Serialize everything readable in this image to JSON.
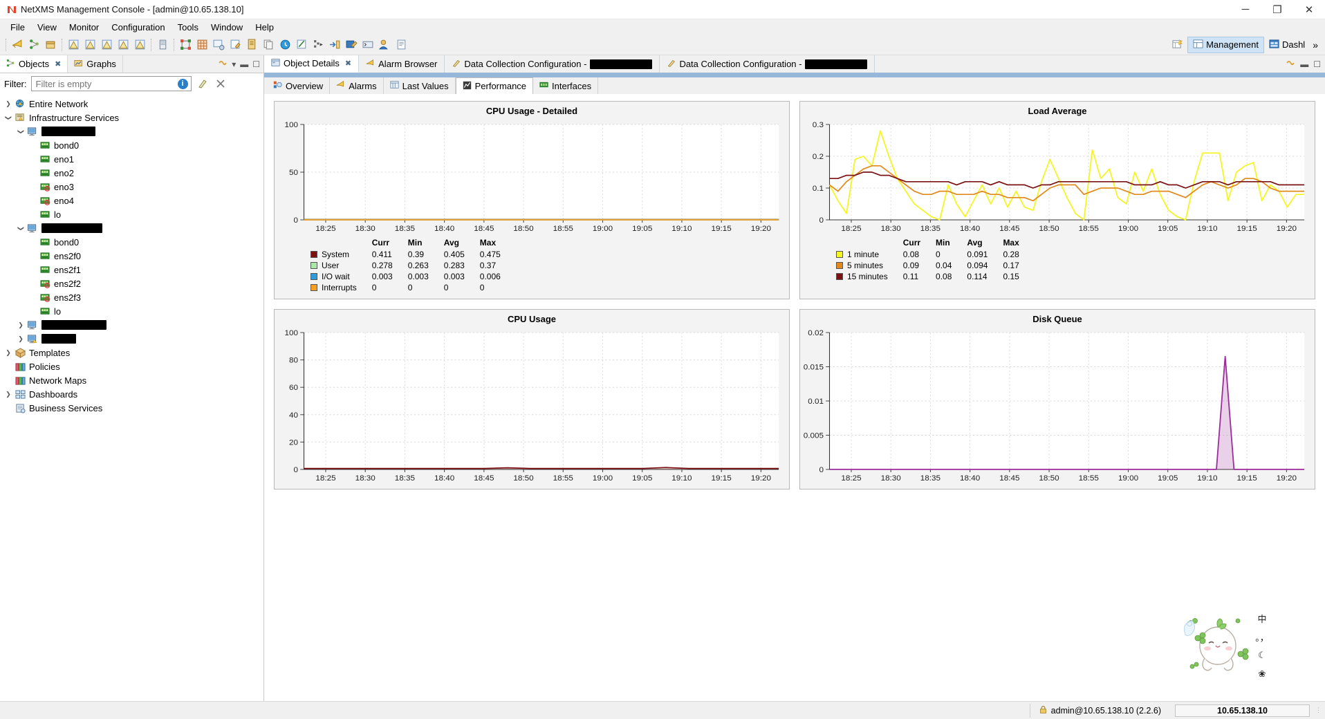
{
  "window": {
    "title": "NetXMS Management Console - [admin@10.65.138.10]",
    "app_icon": "netxms-logo-icon",
    "minimize": "─",
    "maximize": "❐",
    "close": "✕"
  },
  "menubar": {
    "items": [
      "File",
      "View",
      "Monitor",
      "Configuration",
      "Tools",
      "Window",
      "Help"
    ]
  },
  "toolbar": {
    "groups": [
      [
        "megaphone-icon",
        "node-poll-icon",
        "package-icon"
      ],
      [
        "alarm-view-icon",
        "alarm-edit-icon",
        "alarm-ack-icon",
        "alarm-resolve-icon",
        "alarm-terminate-icon"
      ],
      [
        "server-icon"
      ],
      [
        "topology-icon",
        "network-map-icon",
        "map-link-icon",
        "edit-note-icon",
        "log-icon",
        "copy-icon",
        "clock-icon",
        "script-icon",
        "execute-icon",
        "import-icon",
        "tools-icon",
        "terminal-icon",
        "user-manager-icon",
        "report-icon"
      ]
    ],
    "perspective": {
      "new_perspective_icon": "new-perspective-icon",
      "management_icon": "management-perspective-icon",
      "management_label": "Management",
      "dashboard_icon": "dashboard-perspective-icon",
      "dashboard_label": "Dashl",
      "more": "»"
    }
  },
  "left_panel": {
    "tabs": [
      {
        "label": "Objects",
        "icon": "objects-tree-icon",
        "active": true,
        "closeable": true
      },
      {
        "label": "Graphs",
        "icon": "graphs-icon",
        "active": false,
        "closeable": false
      }
    ],
    "tab_actions": [
      "view-menu-icon",
      "minimize-view-icon",
      "maximize-view-icon"
    ],
    "filter": {
      "label": "Filter:",
      "placeholder": "Filter is empty",
      "value": "",
      "info_icon": "info-icon",
      "clear_icon": "clear-filter-icon",
      "collapse_icon": "collapse-all-icon"
    },
    "tree": [
      {
        "indent": 0,
        "twisty": "collapsed",
        "icon": "globe-warning-icon",
        "label": "Entire Network",
        "redacted": 0
      },
      {
        "indent": 0,
        "twisty": "expanded",
        "icon": "infrastructure-warning-icon",
        "label": "Infrastructure Services",
        "redacted": 0
      },
      {
        "indent": 1,
        "twisty": "expanded",
        "icon": "node-icon",
        "label": "",
        "redacted": 78
      },
      {
        "indent": 2,
        "twisty": "none",
        "icon": "interface-icon",
        "label": "bond0",
        "redacted": 0
      },
      {
        "indent": 2,
        "twisty": "none",
        "icon": "interface-icon",
        "label": "eno1",
        "redacted": 0
      },
      {
        "indent": 2,
        "twisty": "none",
        "icon": "interface-icon",
        "label": "eno2",
        "redacted": 0
      },
      {
        "indent": 2,
        "twisty": "none",
        "icon": "interface-down-icon",
        "label": "eno3",
        "redacted": 0
      },
      {
        "indent": 2,
        "twisty": "none",
        "icon": "interface-down-icon",
        "label": "eno4",
        "redacted": 0
      },
      {
        "indent": 2,
        "twisty": "none",
        "icon": "interface-icon",
        "label": "lo",
        "redacted": 0
      },
      {
        "indent": 1,
        "twisty": "expanded",
        "icon": "node-icon",
        "label": "",
        "redacted": 88
      },
      {
        "indent": 2,
        "twisty": "none",
        "icon": "interface-icon",
        "label": "bond0",
        "redacted": 0
      },
      {
        "indent": 2,
        "twisty": "none",
        "icon": "interface-icon",
        "label": "ens2f0",
        "redacted": 0
      },
      {
        "indent": 2,
        "twisty": "none",
        "icon": "interface-icon",
        "label": "ens2f1",
        "redacted": 0
      },
      {
        "indent": 2,
        "twisty": "none",
        "icon": "interface-down-icon",
        "label": "ens2f2",
        "redacted": 0
      },
      {
        "indent": 2,
        "twisty": "none",
        "icon": "interface-down-icon",
        "label": "ens2f3",
        "redacted": 0
      },
      {
        "indent": 2,
        "twisty": "none",
        "icon": "interface-icon",
        "label": "lo",
        "redacted": 0
      },
      {
        "indent": 1,
        "twisty": "collapsed",
        "icon": "node-icon",
        "label": "",
        "redacted": 94
      },
      {
        "indent": 1,
        "twisty": "collapsed",
        "icon": "node-warning-icon",
        "label": "",
        "redacted": 50
      },
      {
        "indent": 0,
        "twisty": "collapsed",
        "icon": "templates-icon",
        "label": "Templates",
        "redacted": 0
      },
      {
        "indent": 0,
        "twisty": "none",
        "icon": "policies-icon",
        "label": "Policies",
        "redacted": 0
      },
      {
        "indent": 0,
        "twisty": "none",
        "icon": "network-maps-icon",
        "label": "Network Maps",
        "redacted": 0
      },
      {
        "indent": 0,
        "twisty": "collapsed",
        "icon": "dashboards-icon",
        "label": "Dashboards",
        "redacted": 0
      },
      {
        "indent": 0,
        "twisty": "none",
        "icon": "business-services-icon",
        "label": "Business Services",
        "redacted": 0
      }
    ]
  },
  "editor": {
    "tabs": [
      {
        "label": "Object Details",
        "icon": "object-details-icon",
        "active": true,
        "closeable": true,
        "redacted": 0
      },
      {
        "label": "Alarm Browser",
        "icon": "alarm-browser-icon",
        "active": false,
        "closeable": false,
        "redacted": 0
      },
      {
        "label": "Data Collection Configuration - ",
        "icon": "data-collection-icon",
        "active": false,
        "closeable": false,
        "redacted": 90
      },
      {
        "label": "Data Collection Configuration - ",
        "icon": "data-collection-icon",
        "active": false,
        "closeable": false,
        "redacted": 90
      }
    ],
    "tab_actions": [
      "restore-view-icon",
      "minimize-view-icon",
      "maximize-view-icon"
    ],
    "inner_tabs": [
      {
        "label": "Overview",
        "icon": "overview-icon",
        "active": false
      },
      {
        "label": "Alarms",
        "icon": "alarms-icon",
        "active": false
      },
      {
        "label": "Last Values",
        "icon": "last-values-icon",
        "active": false
      },
      {
        "label": "Performance",
        "icon": "performance-icon",
        "active": true
      },
      {
        "label": "Interfaces",
        "icon": "interfaces-icon",
        "active": false
      }
    ]
  },
  "ime": {
    "mascot": "cute-rabbit-mascot-icon",
    "buttons": [
      {
        "icon": "chinese-mode-icon",
        "label": "中"
      },
      {
        "icon": "punctuation-mode-icon",
        "label": "。，"
      },
      {
        "icon": "moon-theme-icon",
        "label": "☾"
      },
      {
        "icon": "butterfly-skin-icon",
        "label": "❀"
      }
    ]
  },
  "statusbar": {
    "lock_icon": "lock-icon",
    "user": "admin@10.65.138.10 (2.2.6)",
    "server_ip": "10.65.138.10",
    "grip": "resize-grip-icon"
  },
  "chart_data": [
    {
      "id": "cpu-usage-detailed",
      "type": "area",
      "title": "CPU Usage - Detailed",
      "xlabel": "",
      "ylabel": "",
      "ylim": [
        0,
        100
      ],
      "yticks": [
        0,
        50,
        100
      ],
      "grid": true,
      "legend_position": "below",
      "x": [
        "18:25",
        "18:30",
        "18:35",
        "18:40",
        "18:45",
        "18:50",
        "18:55",
        "19:00",
        "19:05",
        "19:10",
        "19:15",
        "19:20"
      ],
      "series": [
        {
          "name": "System",
          "color": "#7b1113",
          "curr": "0.411",
          "min": "0.39",
          "avg": "0.405",
          "max": "0.475",
          "values": [
            0.41,
            0.4,
            0.41,
            0.41,
            0.4,
            0.41,
            0.42,
            0.41,
            0.4,
            0.41,
            0.42,
            0.41
          ]
        },
        {
          "name": "User",
          "color": "#a9e8a9",
          "curr": "0.278",
          "min": "0.263",
          "avg": "0.283",
          "max": "0.37",
          "values": [
            0.28,
            0.27,
            0.28,
            0.29,
            0.28,
            0.27,
            0.3,
            0.28,
            0.27,
            0.29,
            0.3,
            0.28
          ]
        },
        {
          "name": "I/O wait",
          "color": "#2f9bdc",
          "curr": "0.003",
          "min": "0.003",
          "avg": "0.003",
          "max": "0.006",
          "values": [
            0.003,
            0.003,
            0.003,
            0.004,
            0.003,
            0.003,
            0.003,
            0.003,
            0.003,
            0.003,
            0.004,
            0.003
          ]
        },
        {
          "name": "Interrupts",
          "color": "#f5a020",
          "curr": "0",
          "min": "0",
          "avg": "0",
          "max": "0",
          "values": [
            0,
            0,
            0,
            0,
            0,
            0,
            0,
            0,
            0,
            0,
            0,
            0
          ]
        }
      ],
      "legend_columns": [
        "",
        "Curr",
        "Min",
        "Avg",
        "Max"
      ]
    },
    {
      "id": "load-average",
      "type": "line",
      "title": "Load Average",
      "xlabel": "",
      "ylabel": "",
      "ylim": [
        0,
        0.3
      ],
      "yticks": [
        0,
        0.1,
        0.2,
        0.3
      ],
      "grid": true,
      "legend_position": "below",
      "x": [
        "18:25",
        "18:30",
        "18:35",
        "18:40",
        "18:45",
        "18:50",
        "18:55",
        "19:00",
        "19:05",
        "19:10",
        "19:15",
        "19:20"
      ],
      "series": [
        {
          "name": "1 minute",
          "color": "#f5f522",
          "curr": "0.08",
          "min": "0",
          "avg": "0.091",
          "max": "0.28",
          "values": [
            0.11,
            0.06,
            0.02,
            0.19,
            0.2,
            0.17,
            0.28,
            0.2,
            0.13,
            0.09,
            0.05,
            0.03,
            0.01,
            0.0,
            0.11,
            0.05,
            0.01,
            0.06,
            0.11,
            0.05,
            0.1,
            0.04,
            0.09,
            0.04,
            0.03,
            0.12,
            0.19,
            0.13,
            0.07,
            0.02,
            0.0,
            0.22,
            0.13,
            0.16,
            0.07,
            0.05,
            0.15,
            0.09,
            0.16,
            0.08,
            0.03,
            0.01,
            0.0,
            0.12,
            0.21,
            0.21,
            0.21,
            0.06,
            0.15,
            0.17,
            0.18,
            0.06,
            0.11,
            0.09,
            0.04,
            0.08,
            0.08
          ]
        },
        {
          "name": "5 minutes",
          "color": "#e08a1e",
          "curr": "0.09",
          "min": "0.04",
          "avg": "0.094",
          "max": "0.17",
          "values": [
            0.11,
            0.09,
            0.12,
            0.14,
            0.16,
            0.17,
            0.17,
            0.15,
            0.13,
            0.11,
            0.09,
            0.08,
            0.08,
            0.09,
            0.09,
            0.08,
            0.08,
            0.08,
            0.09,
            0.08,
            0.08,
            0.07,
            0.07,
            0.07,
            0.06,
            0.08,
            0.1,
            0.11,
            0.11,
            0.11,
            0.08,
            0.09,
            0.1,
            0.1,
            0.1,
            0.09,
            0.08,
            0.08,
            0.09,
            0.09,
            0.09,
            0.08,
            0.07,
            0.09,
            0.11,
            0.12,
            0.11,
            0.1,
            0.11,
            0.13,
            0.13,
            0.12,
            0.1,
            0.09,
            0.09,
            0.09,
            0.09
          ]
        },
        {
          "name": "15 minutes",
          "color": "#7b1113",
          "curr": "0.11",
          "min": "0.08",
          "avg": "0.114",
          "max": "0.15",
          "values": [
            0.13,
            0.13,
            0.14,
            0.14,
            0.15,
            0.15,
            0.14,
            0.14,
            0.13,
            0.12,
            0.12,
            0.12,
            0.12,
            0.12,
            0.12,
            0.11,
            0.12,
            0.12,
            0.12,
            0.11,
            0.12,
            0.11,
            0.11,
            0.11,
            0.1,
            0.11,
            0.11,
            0.12,
            0.12,
            0.12,
            0.12,
            0.12,
            0.12,
            0.12,
            0.12,
            0.12,
            0.11,
            0.11,
            0.11,
            0.12,
            0.11,
            0.11,
            0.1,
            0.11,
            0.12,
            0.12,
            0.12,
            0.11,
            0.12,
            0.12,
            0.12,
            0.12,
            0.12,
            0.11,
            0.11,
            0.11,
            0.11
          ]
        }
      ],
      "legend_columns": [
        "",
        "Curr",
        "Min",
        "Avg",
        "Max"
      ]
    },
    {
      "id": "cpu-usage",
      "type": "area",
      "title": "CPU Usage",
      "xlabel": "",
      "ylabel": "",
      "ylim": [
        0,
        100
      ],
      "yticks": [
        0,
        20,
        40,
        60,
        80,
        100
      ],
      "grid": true,
      "legend_position": "none",
      "x": [
        "18:25",
        "18:30",
        "18:35",
        "18:40",
        "18:45",
        "18:50",
        "18:55",
        "19:00",
        "19:05",
        "19:10",
        "19:15",
        "19:20"
      ],
      "series": [
        {
          "name": "CPU Usage",
          "color": "#7b1113",
          "values": [
            0.7,
            0.7,
            0.7,
            0.7,
            0.7,
            0.7,
            0.7,
            0.7,
            0.7,
            1.2,
            0.7,
            0.7,
            0.7,
            0.7,
            0.7,
            0.7,
            1.4,
            0.7,
            0.7,
            0.7,
            0.7,
            0.7
          ]
        }
      ]
    },
    {
      "id": "disk-queue",
      "type": "area",
      "title": "Disk Queue",
      "xlabel": "",
      "ylabel": "",
      "ylim": [
        0,
        0.02
      ],
      "yticks": [
        0,
        0.005,
        0.01,
        0.015,
        0.02
      ],
      "grid": true,
      "legend_position": "none",
      "x": [
        "18:25",
        "18:30",
        "18:35",
        "18:40",
        "18:45",
        "18:50",
        "18:55",
        "19:00",
        "19:05",
        "19:10",
        "19:15",
        "19:20"
      ],
      "series": [
        {
          "name": "Disk Queue",
          "color": "#9b2d9b",
          "values": [
            0,
            0,
            0,
            0,
            0,
            0,
            0,
            0,
            0,
            0,
            0,
            0,
            0,
            0,
            0,
            0,
            0,
            0,
            0,
            0,
            0,
            0,
            0,
            0,
            0,
            0,
            0,
            0,
            0,
            0,
            0,
            0,
            0,
            0,
            0,
            0,
            0,
            0,
            0,
            0,
            0,
            0,
            0,
            0,
            0,
            0.0165,
            0,
            0,
            0,
            0,
            0,
            0,
            0,
            0,
            0
          ]
        }
      ]
    }
  ]
}
